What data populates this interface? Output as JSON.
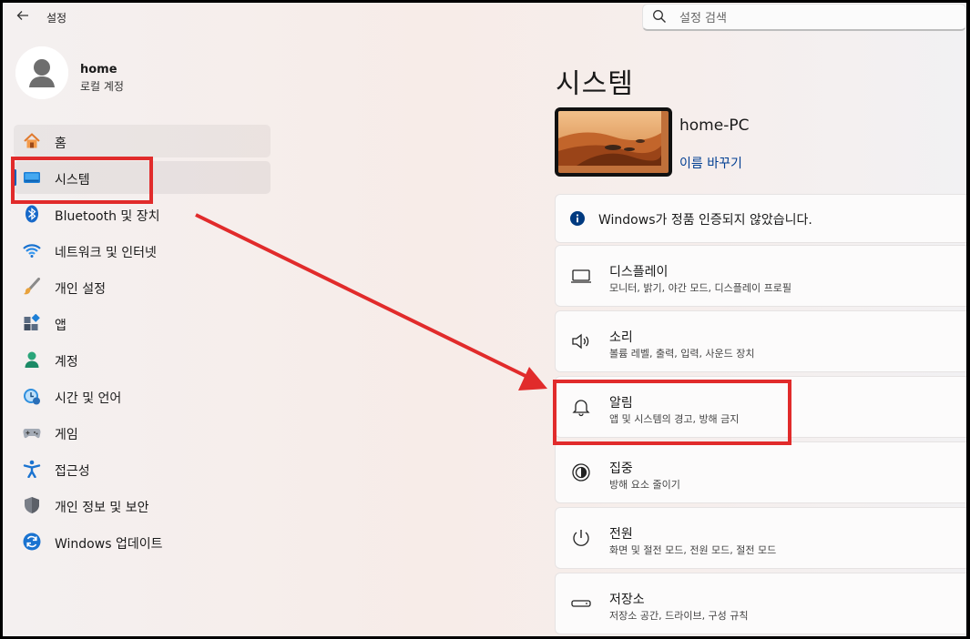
{
  "window": {
    "title": "설정"
  },
  "search": {
    "placeholder": "설정 검색"
  },
  "profile": {
    "name": "home",
    "account_type": "로컬 계정"
  },
  "sidebar": {
    "items": [
      {
        "label": "홈",
        "icon": "home-icon"
      },
      {
        "label": "시스템",
        "icon": "system-icon",
        "selected": true
      },
      {
        "label": "Bluetooth 및 장치",
        "icon": "bluetooth-icon"
      },
      {
        "label": "네트워크 및 인터넷",
        "icon": "wifi-icon"
      },
      {
        "label": "개인 설정",
        "icon": "brush-icon"
      },
      {
        "label": "앱",
        "icon": "apps-icon"
      },
      {
        "label": "계정",
        "icon": "account-icon"
      },
      {
        "label": "시간 및 언어",
        "icon": "clock-globe-icon"
      },
      {
        "label": "게임",
        "icon": "gamepad-icon"
      },
      {
        "label": "접근성",
        "icon": "accessibility-icon"
      },
      {
        "label": "개인 정보 및 보안",
        "icon": "shield-icon"
      },
      {
        "label": "Windows 업데이트",
        "icon": "update-icon"
      }
    ]
  },
  "main": {
    "title": "시스템",
    "device": {
      "name": "home-PC",
      "rename_label": "이름 바꾸기"
    },
    "notice": {
      "text": "Windows가 정품 인증되지 않았습니다.",
      "icon": "info-icon"
    },
    "settings": [
      {
        "title": "디스플레이",
        "subtitle": "모니터, 밝기, 야간 모드, 디스플레이 프로필",
        "icon": "display-icon"
      },
      {
        "title": "소리",
        "subtitle": "볼륨 레벨, 출력, 입력, 사운드 장치",
        "icon": "speaker-icon"
      },
      {
        "title": "알림",
        "subtitle": "앱 및 시스템의 경고, 방해 금지",
        "icon": "bell-icon"
      },
      {
        "title": "집중",
        "subtitle": "방해 요소 줄이기",
        "icon": "focus-icon"
      },
      {
        "title": "전원",
        "subtitle": "화면 및 절전 모드, 전원 모드, 절전 모드",
        "icon": "power-icon"
      },
      {
        "title": "저장소",
        "subtitle": "저장소 공간, 드라이브, 구성 규칙",
        "icon": "storage-icon"
      }
    ]
  },
  "colors": {
    "accent": "#005fb8",
    "annotation_red": "#e12b2b",
    "link": "#003e92"
  }
}
